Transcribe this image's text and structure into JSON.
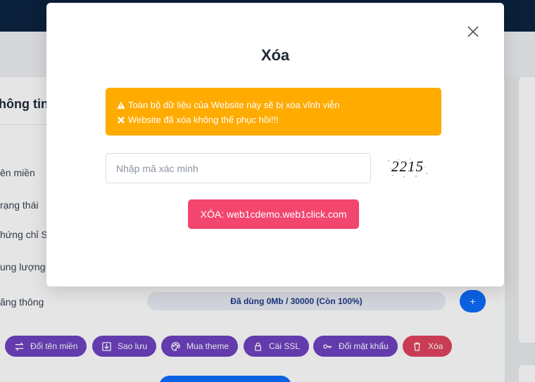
{
  "background": {
    "card_title": "hông tin",
    "rows": [
      {
        "label": "ên miền"
      },
      {
        "label": "rạng thái"
      },
      {
        "label": "hứng chỉ SS"
      },
      {
        "label": "ung lượng"
      },
      {
        "label": "ăng thông"
      }
    ],
    "bandwidth_text": "Đã dùng 0Mb / 30000 (Còn 100%)",
    "plus_label": "+",
    "actions": [
      {
        "label": "Đổi tên miền",
        "icon": "swap-icon"
      },
      {
        "label": "Sao lưu",
        "icon": "download-icon"
      },
      {
        "label": "Mua theme",
        "icon": "palette-icon"
      },
      {
        "label": "Cài SSL",
        "icon": "lock-icon"
      },
      {
        "label": "Đổi mật khẩu",
        "icon": "key-icon"
      },
      {
        "label": "Xóa",
        "icon": "trash-icon"
      }
    ]
  },
  "modal": {
    "title": "Xóa",
    "warning_line1": "Toàn bộ dữ liệu của Website này sẽ bị xóa vĩnh viễn",
    "warning_line2": "Website đã xóa không thể phục hồi!!!",
    "input_placeholder": "Nhập mã xác minh",
    "input_value": "",
    "captcha": "2215",
    "delete_button": "XÓA: web1cdemo.web1click.com"
  },
  "colors": {
    "topbar": "#0c2340",
    "warning": "#ffab00",
    "delete_button": "#f2466f",
    "action_button": "#6f42c1",
    "action_danger": "#e0435e",
    "primary": "#0d6efd"
  }
}
